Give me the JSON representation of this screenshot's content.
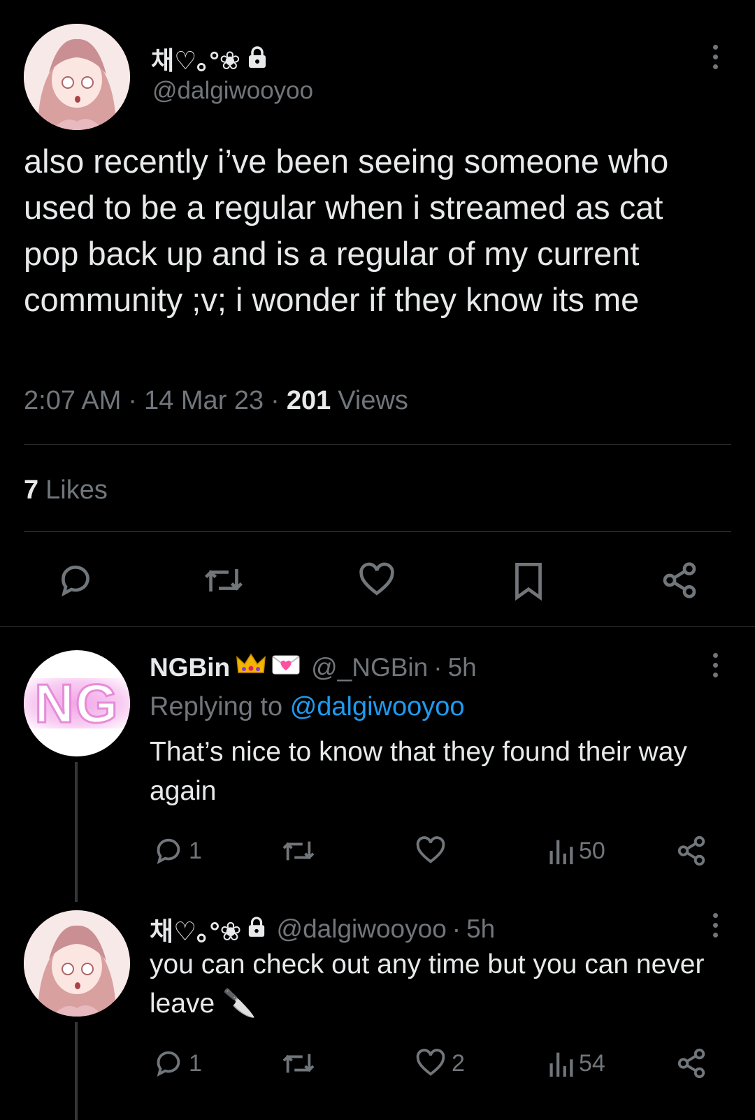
{
  "main_tweet": {
    "display_name": "채♡｡°❀",
    "handle": "@dalgiwooyoo",
    "text": "also recently i’ve been seeing someone who used to be a regular when i streamed as cat pop back up and is a regular of my current community ;v; i wonder if they know its me",
    "time": "2:07 AM",
    "date": "14 Mar 23",
    "views_count": "201",
    "views_label": "Views",
    "likes_count": "7",
    "likes_label": "Likes",
    "separator": "·"
  },
  "reply1": {
    "display_name": "NGBin",
    "handle": "@_NGBin",
    "time": "5h",
    "replying_label": "Replying to",
    "replying_handle": "@dalgiwooyoo",
    "text": "That’s nice to know that they found their way again",
    "reply_count": "1",
    "views_count": "50",
    "avatar_text": "NG"
  },
  "reply2": {
    "display_name": "채♡｡°❀",
    "handle": "@dalgiwooyoo",
    "time": "5h",
    "text": "you can check out any time but you can never leave 🔪",
    "reply_count": "1",
    "like_count": "2",
    "views_count": "54"
  },
  "colors": {
    "background": "#000000",
    "text": "#e7e9ea",
    "muted": "#71767b",
    "link": "#1d9bf0",
    "divider": "#2f3336"
  },
  "icons": [
    "lock-icon",
    "kebab-icon",
    "reply-icon",
    "retweet-icon",
    "like-icon",
    "bookmark-icon",
    "share-icon",
    "views-icon",
    "crown-icon",
    "envelope-icon"
  ]
}
